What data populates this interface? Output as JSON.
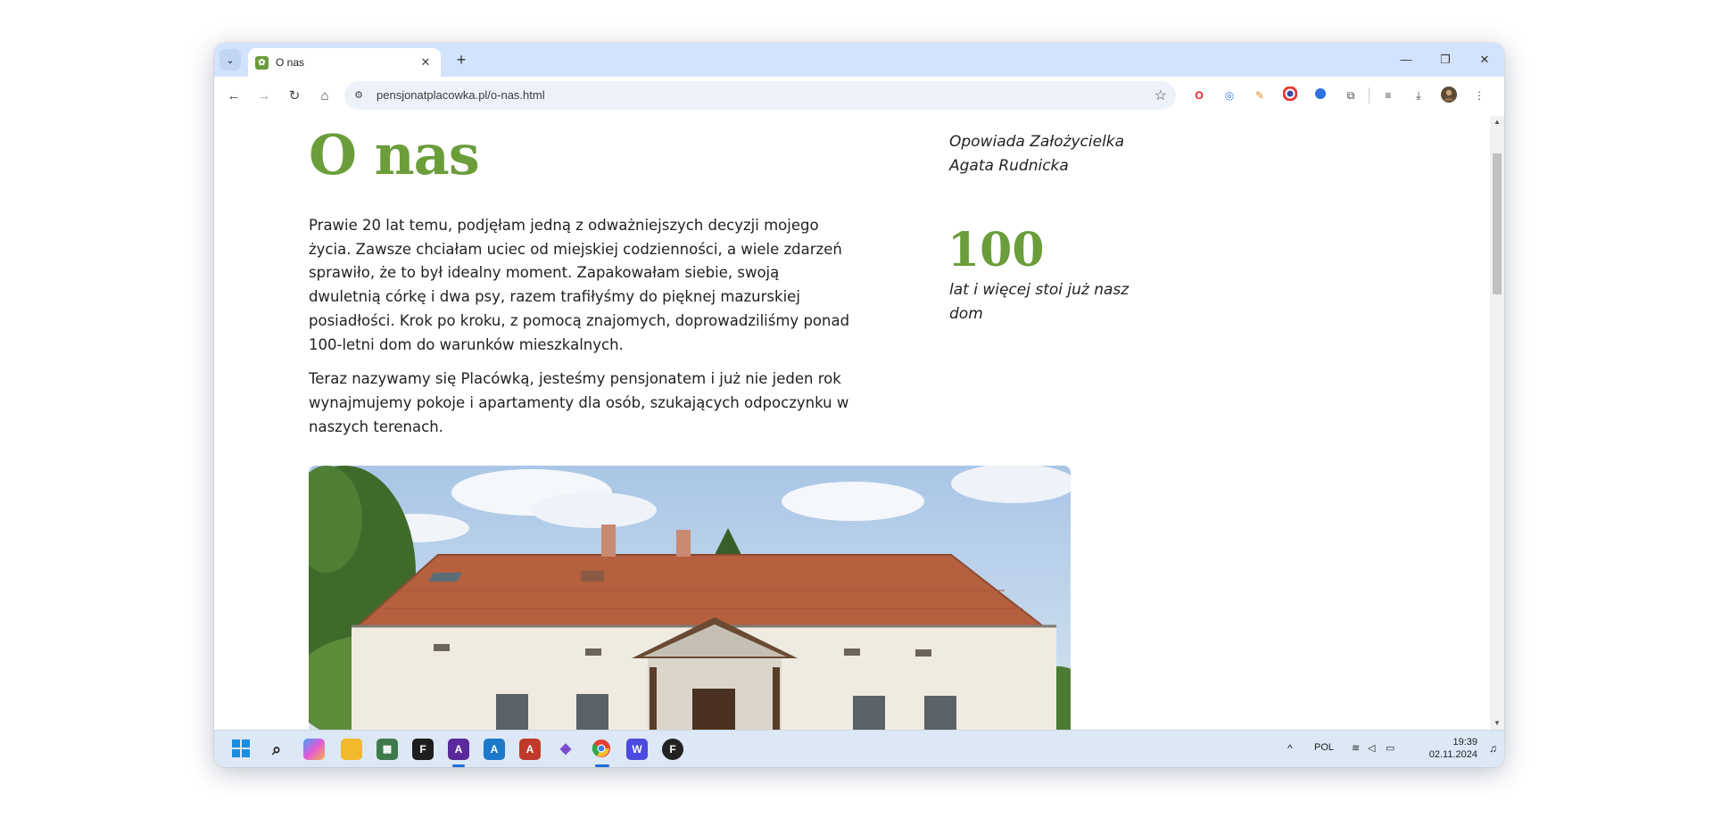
{
  "browser": {
    "tab": {
      "title": "O nas",
      "favicon": "leaf-logo-icon"
    },
    "new_tab_label": "+",
    "address": {
      "url": "pensjonatplacowka.pl/o-nas.html"
    },
    "extensions": [
      "opera-icon",
      "target-icon",
      "paint-icon",
      "color-picker-icon",
      "blue-dot-icon",
      "puzzle-icon",
      "media-queue-icon",
      "download-icon",
      "avatar"
    ]
  },
  "page": {
    "title": "O nas",
    "paragraphs": [
      "Prawie 20 lat temu, podjęłam jedną z odważniejszych decyzji mojego życia. Zawsze chciałam uciec od miejskiej codzienności, a wiele zdarzeń sprawiło, że to był idealny moment. Zapakowałam siebie, swoją dwuletnią córkę i dwa psy, razem trafiłyśmy do pięknej mazurskiej posiadłości. Krok po kroku, z pomocą znajomych, doprowadziliśmy ponad 100-letni dom do warunków mieszkalnych.",
      "Teraz nazywamy się Placówką, jesteśmy pensjonatem i już nie jeden rok wynajmujemy pokoje i apartamenty dla osób, szukających odpoczynku w naszych terenach."
    ],
    "founder_line1": "Opowiada Założycielka",
    "founder_line2": "Agata Rudnicka",
    "stat_number": "100",
    "stat_caption": "lat i więcej stoi już nasz dom",
    "accent_color": "#6b9d3a"
  },
  "taskbar": {
    "apps": [
      "windows-start-icon",
      "search-icon",
      "copilot-icon",
      "file-explorer-icon",
      "task-manager-icon",
      "figma-icon",
      "affinity-photo-icon",
      "affinity-designer-icon",
      "affinity-publisher-icon",
      "vpn-icon",
      "chrome-icon",
      "word-icon",
      "fontbase-icon"
    ],
    "tray": {
      "chevron": "^",
      "language": "POL",
      "time": "19:39",
      "date": "02.11.2024"
    }
  }
}
